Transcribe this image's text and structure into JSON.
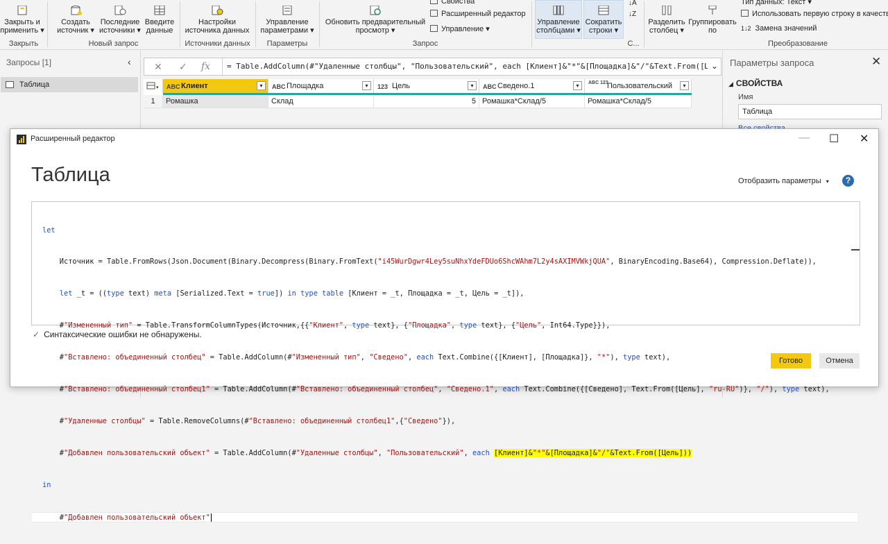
{
  "ribbon": {
    "buttons": [
      {
        "id": "close-apply",
        "line1": "Закрыть и",
        "line2": "применить ▾"
      },
      {
        "id": "create-source",
        "line1": "Создать",
        "line2": "источник ▾"
      },
      {
        "id": "recent-sources",
        "line1": "Последние",
        "line2": "источники ▾"
      },
      {
        "id": "enter-data",
        "line1": "Введите",
        "line2": "данные"
      },
      {
        "id": "source-settings",
        "line1": "Настройки",
        "line2": "источника данных"
      },
      {
        "id": "manage-params",
        "line1": "Управление",
        "line2": "параметрами ▾"
      },
      {
        "id": "refresh-preview",
        "line1": "Обновить предварительный",
        "line2": "просмотр ▾"
      },
      {
        "id": "manage-columns",
        "line1": "Управление",
        "line2": "столбцами ▾"
      },
      {
        "id": "reduce-rows",
        "line1": "Сократить",
        "line2": "строки ▾"
      },
      {
        "id": "split-column",
        "line1": "Разделить",
        "line2": "столбец ▾"
      },
      {
        "id": "group-by",
        "line1": "Группировать",
        "line2": "по"
      }
    ],
    "small": {
      "properties": "Свойства",
      "advanced_editor": "Расширенный редактор",
      "manage": "Управление ▾",
      "data_type": "Тип данных: Текст ▾",
      "first_row": "Использовать первую строку в качеств",
      "replace_values": "Замена значений"
    },
    "groups": {
      "close": "Закрыть",
      "new_query": "Новый запрос",
      "data_sources": "Источники данных",
      "parameters": "Параметры",
      "query": "Запрос",
      "c": "С...",
      "transform": "Преобразование"
    }
  },
  "queries": {
    "header": "Запросы [1]",
    "items": [
      "Таблица"
    ]
  },
  "formula_bar": {
    "text": "= Table.AddColumn(#\"Удаленные столбцы\", \"Пользовательский\", each [Клиент]&\"*\"&[Площадка]&\"/\"&Text.From([Цель]"
  },
  "grid": {
    "columns": [
      {
        "type": "ABC",
        "name": "Клиент"
      },
      {
        "type": "ABC",
        "name": "Площадка"
      },
      {
        "type": "123",
        "name": "Цель"
      },
      {
        "type": "ABC",
        "name": "Сведено.1"
      },
      {
        "type": "ABC 123",
        "name": "Пользовательский"
      }
    ],
    "rows": [
      {
        "num": "1",
        "cells": [
          "Ромашка",
          "Склад",
          "5",
          "Ромашка*Склад/5",
          "Ромашка*Склад/5"
        ]
      }
    ]
  },
  "settings": {
    "title": "Параметры запроса",
    "section": "СВОЙСТВА",
    "name_label": "Имя",
    "name_value": "Таблица",
    "all_props": "Все свойства"
  },
  "dialog": {
    "window_title": "Расширенный редактор",
    "heading": "Таблица",
    "display_options": "Отобразить параметры",
    "status": "Синтаксические ошибки не обнаружены.",
    "done": "Готово",
    "cancel": "Отмена"
  },
  "code": [
    "let",
    "    Источник = Table.FromRows(Json.Document(Binary.Decompress(Binary.FromText(\"i45WurDgwr4Ley5suNhxYdeFDUo6ShcWAhm7L2y4sAXIMVWkjQUA\", BinaryEncoding.Base64), Compression.Deflate)),",
    "    let _t = ((type text) meta [Serialized.Text = true]) in type table [Клиент = _t, Площадка = _t, Цель = _t]),",
    "    #\"Измененный тип\" = Table.TransformColumnTypes(Источник,{{\"Клиент\", type text}, {\"Площадка\", type text}, {\"Цель\", Int64.Type}}),",
    "    #\"Вставлено: объединенный столбец\" = Table.AddColumn(#\"Измененный тип\", \"Сведено\", each Text.Combine({[Клиент], [Площадка]}, \"*\"), type text),",
    "    #\"Вставлено: объединенный столбец1\" = Table.AddColumn(#\"Вставлено: объединенный столбец\", \"Сведено.1\", each Text.Combine({[Сведено], Text.From([Цель], \"ru-RU\")}, \"/\"), type text),",
    "    #\"Удаленные столбцы\" = Table.RemoveColumns(#\"Вставлено: объединенный столбец1\",{\"Сведено\"}),",
    "    #\"Добавлен пользовательский объект\" = Table.AddColumn(#\"Удаленные столбцы\", \"Пользовательский\", each [Клиент]&\"*\"&[Площадка]&\"/\"&Text.From([Цель]))",
    "in",
    "    #\"Добавлен пользовательский объект\""
  ],
  "colors": {
    "accent_yellow": "#f2c811",
    "teal_line": "#27a59a",
    "keyword_blue": "#2451c4",
    "string_red": "#a31515",
    "highlight": "#ffff00"
  }
}
